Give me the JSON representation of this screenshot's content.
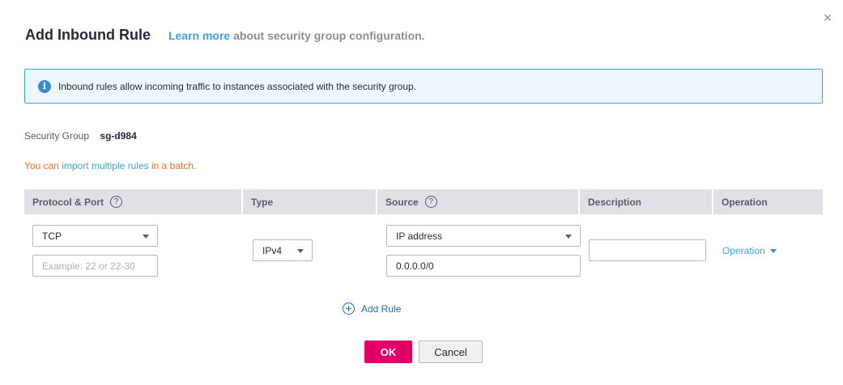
{
  "dialog": {
    "title": "Add Inbound Rule",
    "learn_more_label": "Learn more",
    "subtitle_rest": " about security group configuration.",
    "close_glyph": "×"
  },
  "info": {
    "icon": "info-icon",
    "icon_glyph": "i",
    "text": "Inbound rules allow incoming traffic to instances associated with the security group."
  },
  "security_group": {
    "label": "Security Group",
    "value": "sg-d984"
  },
  "batch": {
    "prefix": "You can ",
    "link": "import multiple rules",
    "suffix": " in a batch."
  },
  "table": {
    "columns": [
      {
        "label": "Protocol & Port",
        "help": "?"
      },
      {
        "label": "Type"
      },
      {
        "label": "Source",
        "help": "?"
      },
      {
        "label": "Description"
      },
      {
        "label": "Operation"
      }
    ],
    "row": {
      "protocol": "TCP",
      "port_placeholder": "Example: 22 or 22-30",
      "type": "IPv4",
      "source_type": "IP address",
      "source_value": "0.0.0.0/0",
      "description": "",
      "operation_label": "Operation"
    }
  },
  "add_rule_label": "Add Rule",
  "add_rule_glyph": "+",
  "buttons": {
    "ok": "OK",
    "cancel": "Cancel"
  },
  "colors": {
    "accent_link": "#3ca5dc",
    "primary_button": "#e1006a",
    "warning_text": "#f66f20",
    "info_border": "#3ca5dc",
    "info_bg": "#eef7fd"
  }
}
